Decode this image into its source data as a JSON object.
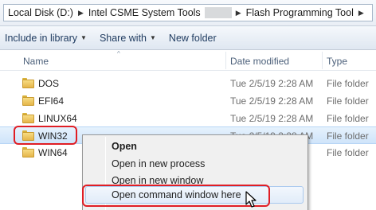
{
  "address": {
    "crumbs": [
      "Local Disk (D:)",
      "Intel CSME System Tools",
      "Flash Programming Tool"
    ],
    "separator": "▶"
  },
  "toolbar": {
    "include_label": "Include in library",
    "share_label": "Share with",
    "newfolder_label": "New folder",
    "caret": "▼"
  },
  "columns": {
    "name": "Name",
    "date": "Date modified",
    "type": "Type",
    "sort_arrow": "^"
  },
  "rows": [
    {
      "name": "DOS",
      "date": "Tue 2/5/19 2:28 AM",
      "type": "File folder"
    },
    {
      "name": "EFI64",
      "date": "Tue 2/5/19 2:28 AM",
      "type": "File folder"
    },
    {
      "name": "LINUX64",
      "date": "Tue 2/5/19 2:28 AM",
      "type": "File folder"
    },
    {
      "name": "WIN32",
      "date": "Tue 2/5/19 2:28 AM",
      "type": "File folder"
    },
    {
      "name": "WIN64",
      "date": "",
      "type": "File folder"
    }
  ],
  "context_menu": {
    "items": [
      "Open",
      "Open in new process",
      "Open in new window",
      "Open command window here"
    ]
  },
  "colors": {
    "highlight": "#e01e25",
    "selection": "#cfe4fa",
    "folder": "#e5b64a"
  }
}
